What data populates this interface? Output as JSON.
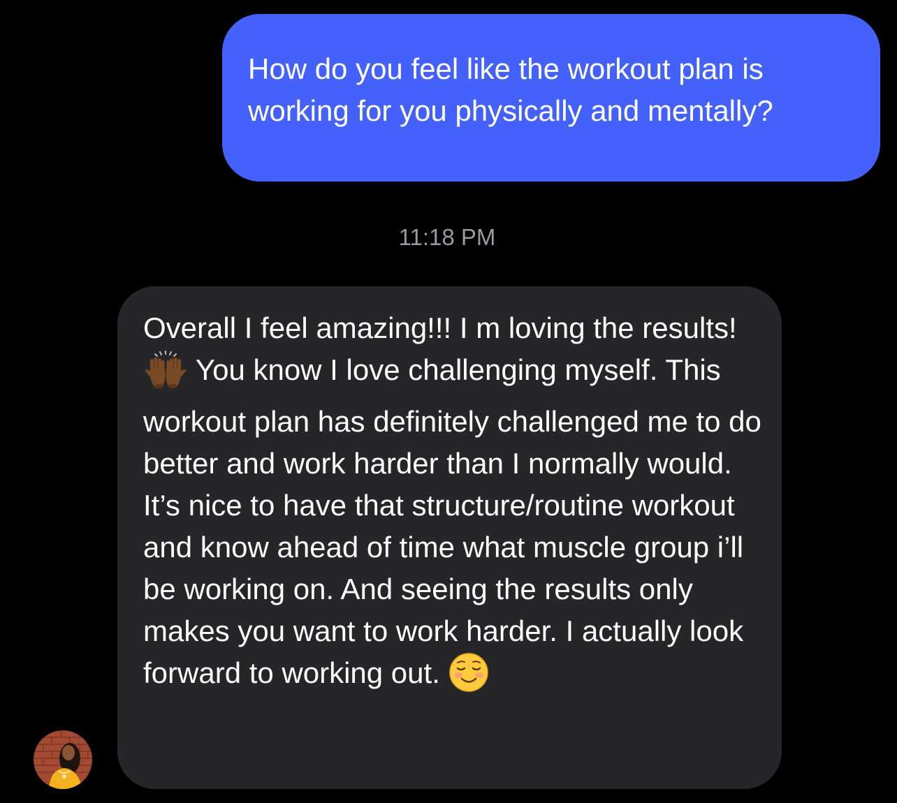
{
  "conversation": {
    "outgoing_message": "How do you feel like the workout plan is working for you physically and mentally?",
    "timestamp": "11:18 PM",
    "incoming_message": {
      "part1": "Overall I feel amazing!!! I m loving the results!",
      "emoji1": "raising-hands-icon",
      "part2": "You know I love challenging myself. This workout plan has definitely challenged me to do better and work harder than I normally would. It’s nice to have that structure/routine workout and know ahead of time what muscle group i’ll be working on. And seeing the results only makes you want to work harder. I actually look forward to working out.",
      "emoji2": "smiling-face-icon"
    }
  },
  "colors": {
    "background": "#000000",
    "outgoing_bubble": "#4461FB",
    "incoming_bubble": "#262628",
    "timestamp_text": "#9A9A9F",
    "message_text": "#FFFFFF"
  }
}
